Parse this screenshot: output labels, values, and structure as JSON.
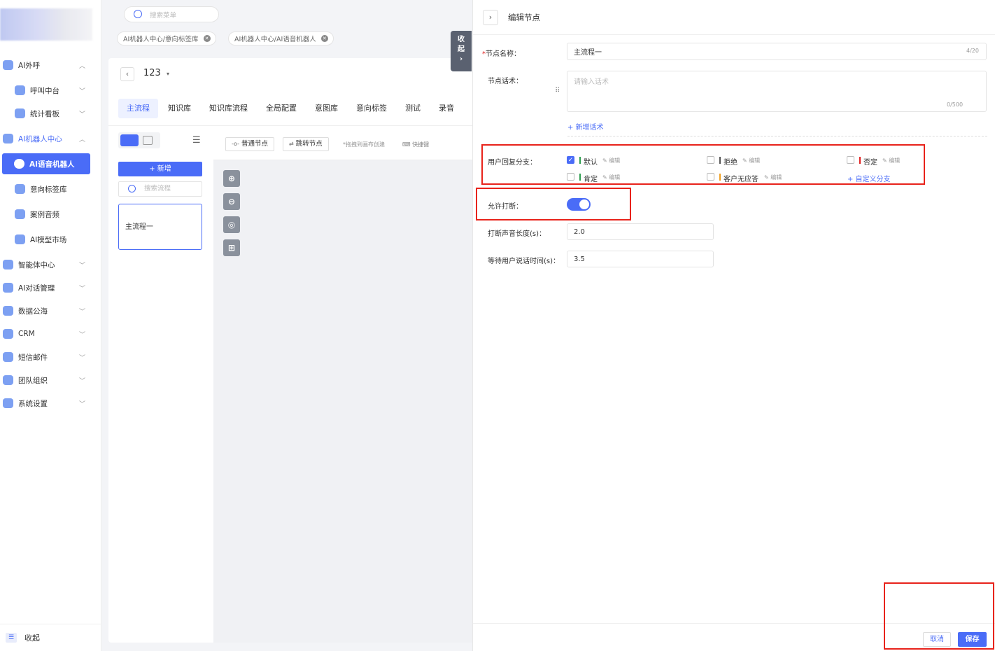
{
  "sidebar": {
    "items": [
      {
        "label": "AI外呼",
        "icon": "phone-user-icon"
      },
      {
        "label": "呼叫中台",
        "icon": "user-icon"
      },
      {
        "label": "统计看板",
        "icon": "chart-icon"
      },
      {
        "label": "AI机器人中心",
        "icon": "robot-icon"
      },
      {
        "label": "AI语音机器人",
        "icon": "chat-icon"
      },
      {
        "label": "意向标签库",
        "icon": "tag-icon"
      },
      {
        "label": "案例音频",
        "icon": "folder-icon"
      },
      {
        "label": "AI模型市场",
        "icon": "cube-icon"
      },
      {
        "label": "智能体中心",
        "icon": "agent-icon"
      },
      {
        "label": "AI对话管理",
        "icon": "dialog-icon"
      },
      {
        "label": "数据公海",
        "icon": "data-icon"
      },
      {
        "label": "CRM",
        "icon": "crm-icon"
      },
      {
        "label": "短信邮件",
        "icon": "mail-icon"
      },
      {
        "label": "团队组织",
        "icon": "team-icon"
      },
      {
        "label": "系统设置",
        "icon": "gear-icon"
      }
    ],
    "collapse_label": "收起"
  },
  "topbar": {
    "search_placeholder": "搜索菜单",
    "breadcrumbs": [
      "AI机器人中心/意向标签库",
      "AI机器人中心/AI语音机器人"
    ],
    "collapse_handle": "收起"
  },
  "project": {
    "name": "123"
  },
  "tabs": [
    "主流程",
    "知识库",
    "知识库流程",
    "全局配置",
    "意图库",
    "意向标签",
    "测试",
    "录音"
  ],
  "flow": {
    "add_label": "+ 新增",
    "search_placeholder": "搜索流程",
    "items": [
      "主流程一"
    ]
  },
  "canvas": {
    "normal_node": "普通节点",
    "jump_node": "跳转节点",
    "drag_hint": "*拖拽到画布创建",
    "shortcut": "快捷键"
  },
  "panel": {
    "title": "编辑节点",
    "node_name_label": "节点名称：",
    "node_name_value": "主流程一",
    "node_name_counter": "4/20",
    "script_label": "节点话术：",
    "script_placeholder": "请输入话术",
    "script_counter": "0/500",
    "add_script": "+ 新增话术",
    "branch_label": "用户回复分支：",
    "branches": [
      {
        "label": "默认",
        "checked": true,
        "color": "#2e9e4f"
      },
      {
        "label": "拒绝",
        "checked": false,
        "color": "#555555"
      },
      {
        "label": "否定",
        "checked": false,
        "color": "#e02020"
      },
      {
        "label": "肯定",
        "checked": false,
        "color": "#2e9e4f"
      },
      {
        "label": "客户无应答",
        "checked": false,
        "color": "#f0a020"
      }
    ],
    "edit_label": "编辑",
    "custom_branch": "+ 自定义分支",
    "interrupt_label": "允许打断：",
    "interrupt_enabled": true,
    "interrupt_length_label": "打断声音长度(s)：",
    "interrupt_length_value": "2.0",
    "wait_label": "等待用户说话时间(s)：",
    "wait_value": "3.5",
    "cancel": "取消",
    "save": "保存"
  },
  "colors": {
    "accent": "#4a6cf7",
    "highlight": "#e8231b"
  }
}
